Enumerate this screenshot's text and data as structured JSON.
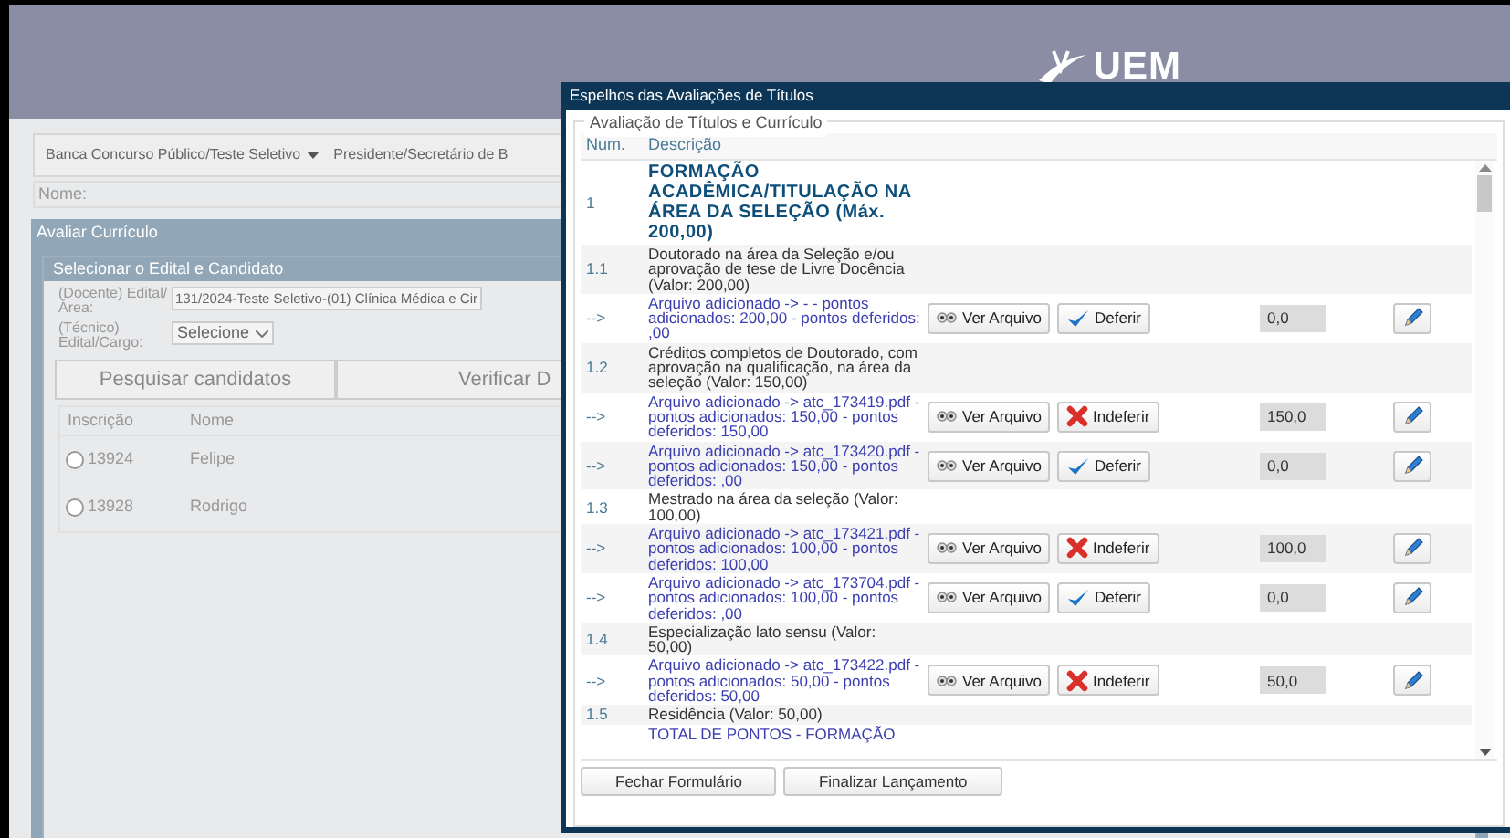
{
  "header": {
    "logo_text": "UEM"
  },
  "toolbar": {
    "menu": "Banca Concurso Público/Teste Seletivo",
    "role": "Presidente/Secretário de B",
    "name_label": "Nome:"
  },
  "panel": {
    "title": "Avaliar Currículo",
    "subpanel_title": "Selecionar o Edital e Candidato",
    "fields": [
      {
        "kind": "text",
        "label": "(Docente) Edital/Área:",
        "value": "131/2024-Teste Seletivo-(01) Clínica Médica e Cir"
      },
      {
        "kind": "select",
        "label": "(Técnico) Edital/Cargo:",
        "value": "Selecione"
      }
    ],
    "buttons": [
      "Pesquisar candidatos",
      "Verificar D"
    ],
    "table": {
      "columns": [
        "Inscrição",
        "Nome"
      ],
      "rows": [
        {
          "inscricao": "13924",
          "nome": "Felipe",
          "selected": false
        },
        {
          "inscricao": "13928",
          "nome": "Rodrigo",
          "selected": false
        }
      ]
    }
  },
  "dialog": {
    "title": "Espelhos das Avaliações de Títulos",
    "legend": "Avaliação de Títulos e Currículo",
    "columns": [
      "Num.",
      "Descrição"
    ],
    "rows": [
      {
        "kind": "heading",
        "num": "1",
        "text": "FORMAÇÃO ACADÊMICA/TITULAÇÃO NA ÁREA DA SELEÇÃO (Máx. 200,00)"
      },
      {
        "kind": "item",
        "num": "1.1",
        "text": "Doutorado na área da Seleção e/ou aprovação de tese de Livre Docência (Valor: 200,00)"
      },
      {
        "kind": "file",
        "num": "-->",
        "text": "Arquivo adicionado -> - - pontos adicionados: 200,00 - pontos deferidos: ,00",
        "view": "Ver Arquivo",
        "action": {
          "kind": "deferir",
          "label": "Deferir"
        },
        "value": "0,0"
      },
      {
        "kind": "item",
        "num": "1.2",
        "text": "Créditos completos de Doutorado, com aprovação na qualificação, na área da seleção (Valor: 150,00)"
      },
      {
        "kind": "file",
        "num": "-->",
        "text": "Arquivo adicionado -> atc_173419.pdf - pontos adicionados: 150,00 - pontos deferidos: 150,00",
        "view": "Ver Arquivo",
        "action": {
          "kind": "indeferir",
          "label": "Indeferir"
        },
        "value": "150,0"
      },
      {
        "kind": "file",
        "num": "-->",
        "text": "Arquivo adicionado -> atc_173420.pdf - pontos adicionados: 150,00 - pontos deferidos: ,00",
        "view": "Ver Arquivo",
        "action": {
          "kind": "deferir",
          "label": "Deferir"
        },
        "value": "0,0"
      },
      {
        "kind": "item",
        "num": "1.3",
        "text": "Mestrado na área da seleção (Valor: 100,00)"
      },
      {
        "kind": "file",
        "num": "-->",
        "text": "Arquivo adicionado -> atc_173421.pdf - pontos adicionados: 100,00 - pontos deferidos: 100,00",
        "view": "Ver Arquivo",
        "action": {
          "kind": "indeferir",
          "label": "Indeferir"
        },
        "value": "100,0"
      },
      {
        "kind": "file",
        "num": "-->",
        "text": "Arquivo adicionado -> atc_173704.pdf - pontos adicionados: 100,00 - pontos deferidos: ,00",
        "view": "Ver Arquivo",
        "action": {
          "kind": "deferir",
          "label": "Deferir"
        },
        "value": "0,0"
      },
      {
        "kind": "item",
        "num": "1.4",
        "text": "Especialização lato sensu (Valor: 50,00)"
      },
      {
        "kind": "file",
        "num": "-->",
        "text": "Arquivo adicionado -> atc_173422.pdf - pontos adicionados: 50,00 - pontos deferidos: 50,00",
        "view": "Ver Arquivo",
        "action": {
          "kind": "indeferir",
          "label": "Indeferir"
        },
        "value": "50,0"
      },
      {
        "kind": "item",
        "num": "1.5",
        "text": "Residência (Valor: 50,00)"
      },
      {
        "kind": "total",
        "text": "TOTAL DE PONTOS - FORMAÇÃO"
      }
    ],
    "buttons": [
      "Fechar Formulário",
      "Finalizar Lançamento"
    ]
  }
}
